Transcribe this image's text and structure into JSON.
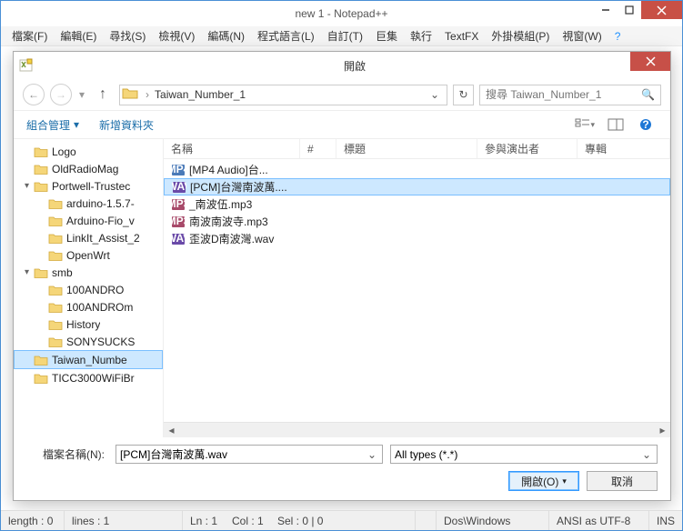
{
  "app": {
    "title": "new  1 - Notepad++"
  },
  "menu": [
    "檔案(F)",
    "編輯(E)",
    "尋找(S)",
    "檢視(V)",
    "編碼(N)",
    "程式語言(L)",
    "自訂(T)",
    "巨集",
    "執行",
    "TextFX",
    "外掛模組(P)",
    "視窗(W)",
    "?"
  ],
  "dialog": {
    "title": "開啟",
    "breadcrumb": {
      "current": "Taiwan_Number_1"
    },
    "search_placeholder": "搜尋 Taiwan_Number_1",
    "toolbar": {
      "organize": "組合管理",
      "new_folder": "新增資料夾"
    },
    "tree": [
      {
        "label": "Logo",
        "depth": 1
      },
      {
        "label": "OldRadioMag",
        "depth": 1
      },
      {
        "label": "Portwell-Trustec",
        "depth": 1,
        "expanded": true
      },
      {
        "label": "arduino-1.5.7-",
        "depth": 2
      },
      {
        "label": "Arduino-Fio_v",
        "depth": 2
      },
      {
        "label": "LinkIt_Assist_2",
        "depth": 2
      },
      {
        "label": "OpenWrt",
        "depth": 2
      },
      {
        "label": "smb",
        "depth": 1,
        "expanded": true
      },
      {
        "label": "100ANDRO",
        "depth": 2
      },
      {
        "label": "100ANDROm",
        "depth": 2
      },
      {
        "label": "History",
        "depth": 2
      },
      {
        "label": "SONYSUCKS",
        "depth": 2
      },
      {
        "label": "Taiwan_Numbe",
        "depth": 1,
        "selected": true
      },
      {
        "label": "TICC3000WiFiBr",
        "depth": 1
      }
    ],
    "columns": {
      "name": "名稱",
      "num": "#",
      "title": "標題",
      "artists": "參與演出者",
      "album": "專輯"
    },
    "files": [
      {
        "name": "[MP4 Audio]台...",
        "type": "mp4"
      },
      {
        "name": "[PCM]台灣南波萬....",
        "type": "wav",
        "selected": true
      },
      {
        "name": "_南波伍.mp3",
        "type": "mp3"
      },
      {
        "name": "南波南波寺.mp3",
        "type": "mp3"
      },
      {
        "name": "歪波D南波灣.wav",
        "type": "wav"
      }
    ],
    "filename_label": "檔案名稱(N):",
    "filename_value": "[PCM]台灣南波萬.wav",
    "filter_value": "All types (*.*)",
    "open_btn": "開啟(O)",
    "cancel_btn": "取消"
  },
  "status": {
    "length": "length : 0",
    "lines": "lines : 1",
    "ln": "Ln : 1",
    "col": "Col : 1",
    "sel": "Sel : 0 | 0",
    "eol": "Dos\\Windows",
    "enc": "ANSI as UTF-8",
    "mode": "INS"
  }
}
